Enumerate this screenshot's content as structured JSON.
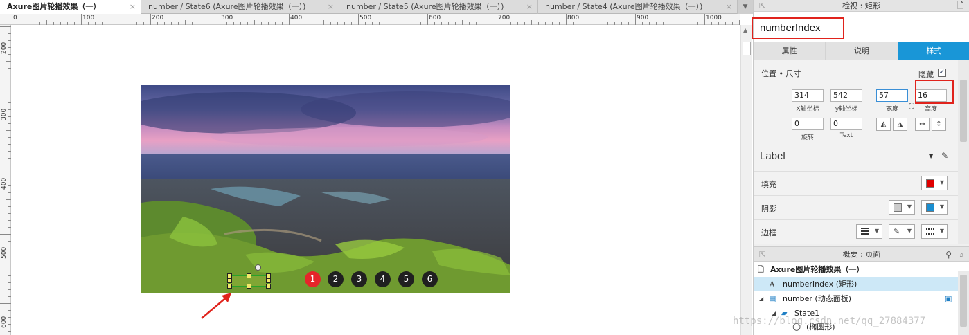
{
  "tabs": [
    {
      "label": "Axure图片轮播效果（一）",
      "active": true
    },
    {
      "label": "number / State6 (Axure图片轮播效果（一）)",
      "active": false
    },
    {
      "label": "number / State5 (Axure图片轮播效果（一）)",
      "active": false
    },
    {
      "label": "number / State4 (Axure图片轮播效果（一）)",
      "active": false
    }
  ],
  "tab_close_glyph": "×",
  "ruler": {
    "h_labels": [
      "0",
      "100",
      "200",
      "300",
      "400",
      "500",
      "600",
      "700",
      "800",
      "900",
      "1000"
    ],
    "v_labels": [
      "200",
      "300",
      "400",
      "500",
      "600"
    ]
  },
  "carousel": {
    "dots": [
      "1",
      "2",
      "3",
      "4",
      "5",
      "6"
    ],
    "active_index": 0,
    "active_color": "#e5252a",
    "dot_color": "#202020"
  },
  "inspector": {
    "title": "检视 : 矩形",
    "name": "numberIndex",
    "tabs": [
      "属性",
      "说明",
      "样式"
    ],
    "active_tab": 2,
    "accent": "#1996d7",
    "section_position": "位置 • 尺寸",
    "hidden_label": "隐藏",
    "hidden_checked": true,
    "check_glyph": "✓",
    "fields": {
      "x": {
        "value": "314",
        "caption": "X轴坐标"
      },
      "y": {
        "value": "542",
        "caption": "y轴坐标"
      },
      "w": {
        "value": "57",
        "caption": "宽度"
      },
      "h": {
        "value": "16",
        "caption": "高度"
      },
      "rotation": {
        "value": "0",
        "caption": "旋转"
      },
      "text": {
        "value": "0",
        "caption": "Text"
      }
    },
    "degree_glyph": "°",
    "style_name": "Label",
    "fill_label": "填充",
    "fill_color": "#e00000",
    "shadow_label": "阴影",
    "shadow_color": "#1a8ed0",
    "border_label": "边框"
  },
  "outline": {
    "title": "概要 : 页面",
    "rows": [
      {
        "label": "Axure图片轮播效果（一）",
        "bold": true
      },
      {
        "label": "numberIndex (矩形)",
        "selected": true
      },
      {
        "label": "number (动态面板)"
      },
      {
        "label": "State1"
      },
      {
        "label": "(椭圆形)"
      }
    ]
  },
  "watermark": "https://blog.csdn.net/qq_27884377"
}
